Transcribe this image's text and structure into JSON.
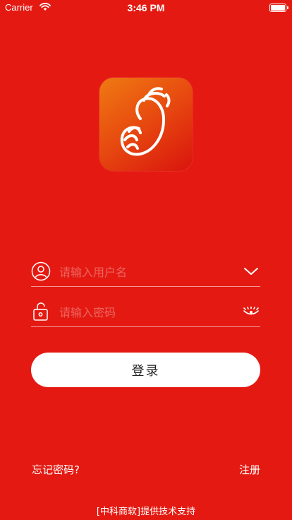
{
  "status_bar": {
    "carrier": "Carrier",
    "time": "3:46 PM"
  },
  "login": {
    "username_placeholder": "请输入用户名",
    "password_placeholder": "请输入密码",
    "login_label": "登录",
    "forgot_label": "忘记密码?",
    "register_label": "注册"
  },
  "footer": {
    "text": "[中科商软]提供技术支持"
  },
  "colors": {
    "background": "#e41a12",
    "button_bg": "#ffffff",
    "button_text": "#222222"
  }
}
